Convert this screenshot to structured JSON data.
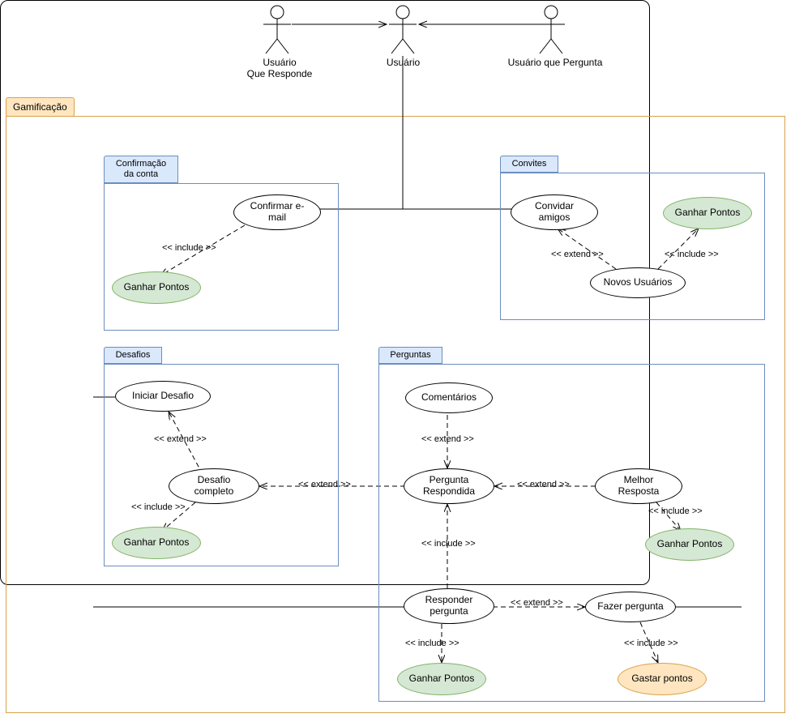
{
  "actors": {
    "responder": "Usuário\nQue Responde",
    "user": "Usuário",
    "asker": "Usuário que Pergunta"
  },
  "package": {
    "label": "Gamificação"
  },
  "sub": {
    "confirm": "Confirmação\nda conta",
    "invites": "Convites",
    "challenges": "Desafios",
    "questions": "Perguntas"
  },
  "uc": {
    "confirm_email": "Confirmar e-\nmail",
    "gp1": "Ganhar Pontos",
    "invite_friends": "Convidar\namigos",
    "gp_invites": "Ganhar Pontos",
    "new_users": "Novos Usuários",
    "start_challenge": "Iniciar Desafio",
    "challenge_complete": "Desafio\ncompleto",
    "gp_challenge": "Ganhar Pontos",
    "comments": "Comentários",
    "answered_q": "Pergunta\nRespondida",
    "best_answer": "Melhor\nResposta",
    "gp_best": "Ganhar Pontos",
    "answer_q": "Responder\npergunta",
    "ask_q": "Fazer pergunta",
    "gp_answer": "Ganhar Pontos",
    "spend_points": "Gastar pontos"
  },
  "rel": {
    "include": "<< include >>",
    "extend": "<< extend >>"
  }
}
